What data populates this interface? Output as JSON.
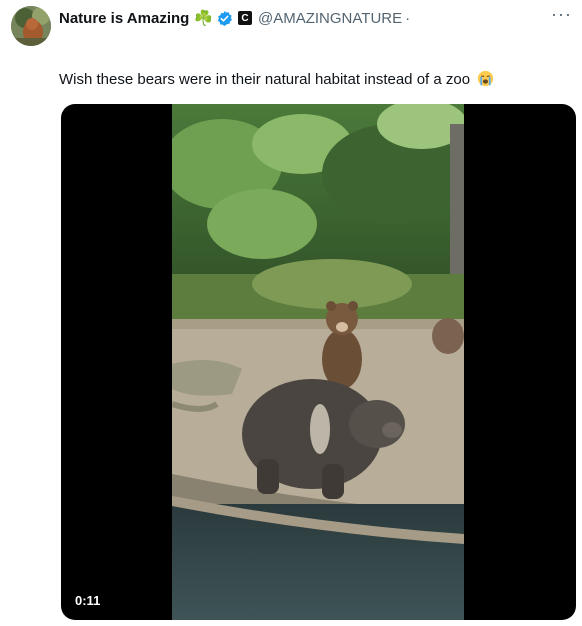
{
  "tweet": {
    "author": {
      "name": "Nature is Amazing",
      "name_emoji": "☘️",
      "handle": "@AMAZINGNATURE",
      "separator": "·",
      "verified": true,
      "affiliate_badge": "C"
    },
    "more_label": "···",
    "text": "Wish these bears were in their natural habitat instead of a zoo",
    "text_emoji": "crying-face",
    "media": {
      "type": "video",
      "duration": "0:11",
      "subject": "brown bears in a zoo enclosure"
    }
  },
  "icons": {
    "verified": "verified-check-icon",
    "affiliate": "affiliate-c-icon",
    "more": "more-options-icon",
    "emoji": "loudly-crying-face-icon"
  },
  "colors": {
    "verified_blue": "#1d9bf0",
    "text_primary": "#0f1419",
    "text_secondary": "#536471",
    "media_background": "#000000"
  }
}
